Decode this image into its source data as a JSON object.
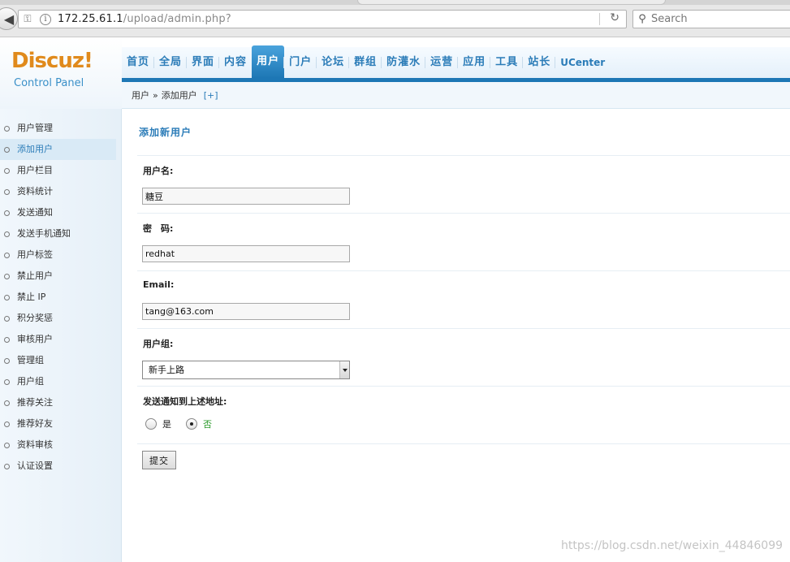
{
  "browser": {
    "url_host": "172.25.61.1",
    "url_path": "/upload/admin.php?",
    "search_placeholder": "Search"
  },
  "header": {
    "logo": "Discuz!",
    "logo_sub": "Control Panel",
    "nav": [
      "首页",
      "全局",
      "界面",
      "内容",
      "用户",
      "门户",
      "论坛",
      "群组",
      "防灌水",
      "运营",
      "应用",
      "工具",
      "站长",
      "UCenter"
    ],
    "active_nav": "用户"
  },
  "breadcrumb": {
    "section": "用户",
    "separator": "»",
    "page": "添加用户",
    "plus": "[+]"
  },
  "sidebar": {
    "items": [
      "用户管理",
      "添加用户",
      "用户栏目",
      "资料统计",
      "发送通知",
      "发送手机通知",
      "用户标签",
      "禁止用户",
      "禁止 IP",
      "积分奖惩",
      "审核用户",
      "管理组",
      "用户组",
      "推荐关注",
      "推荐好友",
      "资料审核",
      "认证设置"
    ],
    "active": "添加用户"
  },
  "form": {
    "title": "添加新用户",
    "username_label": "用户名:",
    "username_value": "糖豆",
    "password_label": "密　码:",
    "password_value": "redhat",
    "email_label": "Email:",
    "email_value": "tang@163.com",
    "group_label": "用户组:",
    "group_value": "新手上路",
    "notify_label": "发送通知到上述地址:",
    "notify_yes": "是",
    "notify_no": "否",
    "notify_selected": "否",
    "submit_label": "提交"
  },
  "watermark": "https://blog.csdn.net/weixin_44846099"
}
